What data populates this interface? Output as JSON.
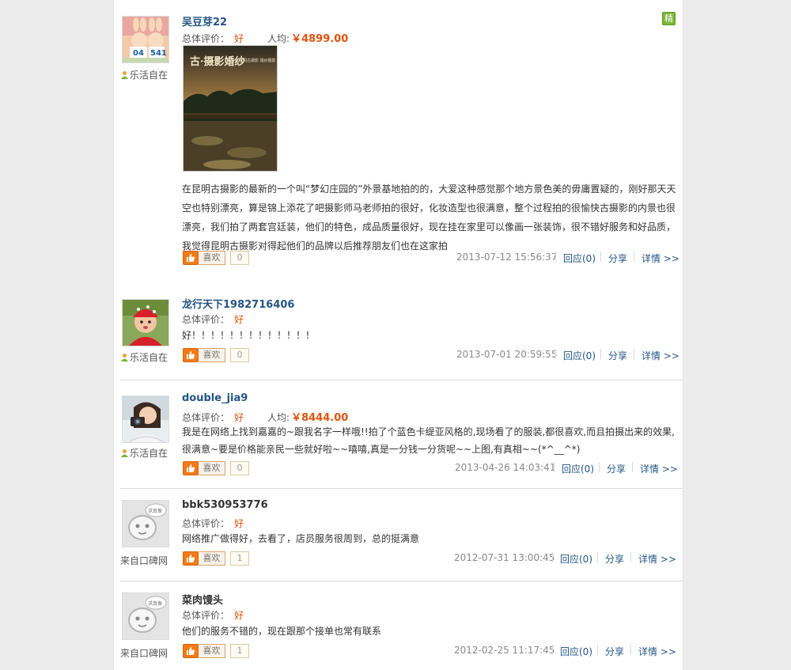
{
  "reviews": [
    {
      "username": "吴豆芽22",
      "user_tag": "乐活自在",
      "rating_label": "总体评价：",
      "rating_value": "好",
      "avg_label": "人均:",
      "avg_price": "￥4899.00",
      "badge": "精",
      "photo_title": "古·摄影婚纱",
      "photo_subtitle": "昆明古摄影 婚纱摄影",
      "content": " 在昆明古摄影的最新的一个叫“梦幻庄园的”外景基地拍的的，大爱这种感觉那个地方景色美的毋庸置疑的，刚好那天天空也特别漂亮，算是锦上添花了吧摄影师马老师拍的很好，化妆造型也很满意，整个过程拍的很愉快古摄影的内景也很漂亮，我们拍了两套宫廷装，他们的特色，成品质量很好，现在挂在家里可以像画一张装饰，很不错好服务和好品质，我觉得昆明古摄影对得起他们的品牌以后推荐朋友们也在这家拍",
      "like_label": "喜欢",
      "like_count": "0",
      "timestamp": "2013-07-12 15:56:37",
      "reply": "回应(0)",
      "share": "分享",
      "detail": "详情 >>"
    },
    {
      "username": "龙行天下1982716406",
      "user_tag": "乐活自在",
      "rating_label": "总体评价：",
      "rating_value": "好",
      "content": "好！！！！！！！！！！！！！",
      "like_label": "喜欢",
      "like_count": "0",
      "timestamp": "2013-07-01 20:59:55",
      "reply": "回应(0)",
      "share": "分享",
      "detail": "详情 >>"
    },
    {
      "username": "double_jia9",
      "user_tag": "乐活自在",
      "rating_label": "总体评价：",
      "rating_value": "好",
      "avg_label": "人均:",
      "avg_price": "￥8444.00",
      "content": "我是在网络上找到嘉嘉的~跟我名字一样哦!!拍了个蓝色卡缇亚风格的,现场看了的服装,都很喜欢,而且拍摄出来的效果,很满意~要是价格能亲民一些就好啦~~嘻嘻,真是一分钱一分货呢~~上图,有真相~~(*^__^*)",
      "like_label": "喜欢",
      "like_count": "0",
      "timestamp": "2013-04-26 14:03:41",
      "reply": "回应(0)",
      "share": "分享",
      "detail": "详情 >>"
    },
    {
      "username": "bbk530953776",
      "user_tag": "来自口碑网",
      "avatar_text": "求真像",
      "rating_label": "总体评价：",
      "rating_value": "好",
      "content": "网络推广做得好，去看了，店员服务很周到，总的挺满意",
      "like_label": "喜欢",
      "like_count": "1",
      "timestamp": "2012-07-31 13:00:45",
      "reply": "回应(0)",
      "share": "分享",
      "detail": "详情 >>"
    },
    {
      "username": "菜肉馒头",
      "user_tag": "来自口碑网",
      "avatar_text": "求真像",
      "rating_label": "总体评价：",
      "rating_value": "好",
      "content": "他们的服务不错的，现在跟那个接单也常有联系",
      "like_label": "喜欢",
      "like_count": "1",
      "timestamp": "2012-02-25 11:17:45",
      "reply": "回应(0)",
      "share": "分享",
      "detail": "详情 >>"
    }
  ],
  "colors": {
    "link": "#245583",
    "accent": "#e1530c",
    "like_button": "#f07b18",
    "badge": "#7cb637"
  }
}
